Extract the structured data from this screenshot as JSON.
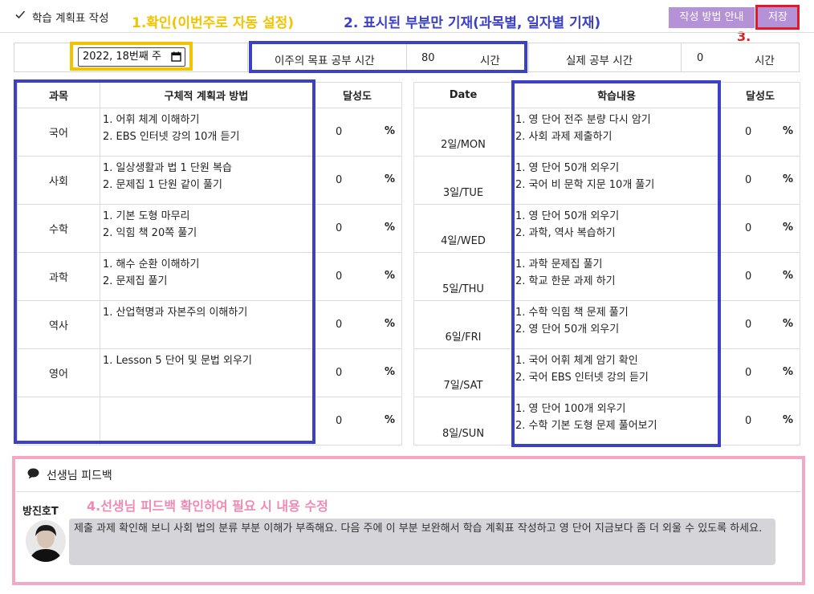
{
  "header": {
    "title": "학습 계획표 작성",
    "guide_button": "작성 방법 안내",
    "save_button": "저장"
  },
  "annotations": {
    "step1": "1.확인(이번주로 자동 설정)",
    "step2": "2. 표시된 부분만 기재(과목별, 일자별 기재)",
    "step3": "3.",
    "step4": "4.선생님 피드백 확인하여 필요 시 내용 수정"
  },
  "goal": {
    "week_value": "2022, 18번째 주",
    "target_label": "이주의 목표 공부 시간",
    "target_value": "80",
    "target_unit": "시간",
    "actual_label": "실제 공부 시간",
    "actual_value": "0",
    "actual_unit": "시간"
  },
  "plan_table": {
    "headers": [
      "과목",
      "구체적 계획과 방법",
      "달성도"
    ],
    "rows": [
      {
        "subject": "국어",
        "plan": [
          "1. 어휘 체계 이해하기",
          "2. EBS 인터넷 강의 10개 듣기"
        ],
        "pct": "0"
      },
      {
        "subject": "사회",
        "plan": [
          "1. 일상생활과 법 1 단원 복습",
          "2. 문제집 1 단원 같이 풀기"
        ],
        "pct": "0"
      },
      {
        "subject": "수학",
        "plan": [
          "1. 기본 도형 마무리",
          "2. 익힘 책 20쪽 풀기"
        ],
        "pct": "0"
      },
      {
        "subject": "과학",
        "plan": [
          "1. 해수 순환 이해하기",
          "2. 문제집 풀기"
        ],
        "pct": "0"
      },
      {
        "subject": "역사",
        "plan": [
          "1. 산업혁명과 자본주의 이해하기",
          ""
        ],
        "pct": "0"
      },
      {
        "subject": "영어",
        "plan": [
          "1. Lesson  5 단어 및 문법 외우기",
          ""
        ],
        "pct": "0"
      },
      {
        "subject": "",
        "plan": [
          "",
          ""
        ],
        "pct": "0"
      }
    ],
    "pct_sign": "%"
  },
  "daily_table": {
    "headers": [
      "Date",
      "학습내용",
      "달성도"
    ],
    "rows": [
      {
        "date": "2일/MON",
        "content": [
          "1. 영 단어 전주 분량 다시 암기",
          "2. 사회 과제 제출하기"
        ],
        "pct": "0"
      },
      {
        "date": "3일/TUE",
        "content": [
          "1. 영 단어 50개 외우기",
          "2. 국어 비 문학 지문 10개 풀기"
        ],
        "pct": "0"
      },
      {
        "date": "4일/WED",
        "content": [
          "1. 영 단어 50개 외우기",
          "2. 과학, 역사 복습하기"
        ],
        "pct": "0"
      },
      {
        "date": "5일/THU",
        "content": [
          "1. 과학 문제집 풀기",
          "2. 학교 한문 과제 하기"
        ],
        "pct": "0"
      },
      {
        "date": "6일/FRI",
        "content": [
          "1. 수학 익힘 책 문제 풀기",
          "2. 영 단어 50개 외우기"
        ],
        "pct": "0"
      },
      {
        "date": "7일/SAT",
        "content": [
          "1. 국어 어휘 체계 암기 확인",
          "2. 국어 EBS 인터넷 강의 듣기"
        ],
        "pct": "0"
      },
      {
        "date": "8일/SUN",
        "content": [
          "1. 영 단어 100개 외우기",
          "2. 수학 기본 도형 문제 풀어보기"
        ],
        "pct": "0"
      }
    ],
    "pct_sign": "%"
  },
  "feedback": {
    "title": "선생님 피드백",
    "teacher_name": "방진호T",
    "message": "제출 과제 확인해 보니 사회 법의 분류 부분 이해가 부족해요. 다음 주에 이 부분 보완해서 학습 계획표 작성하고 영 단어 지금보다 좀 더 외울 수 있도록 하세요."
  },
  "colors": {
    "button_purple": "#b592d8",
    "annotation_yellow": "#f2c300",
    "annotation_blue": "#3b40c7",
    "annotation_red": "#e01a2b",
    "annotation_pink": "#f5a7c6",
    "bubble_gray": "#d4d4d9"
  }
}
